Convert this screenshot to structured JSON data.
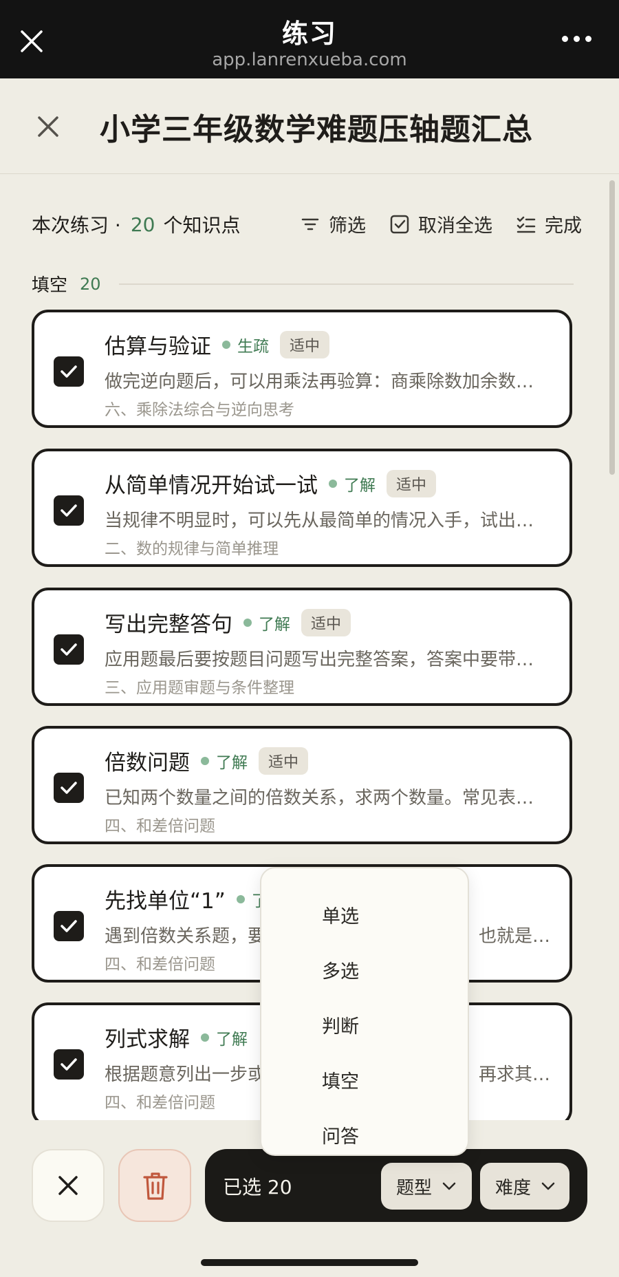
{
  "browser": {
    "title": "练习",
    "url": "app.lanrenxueba.com"
  },
  "header": {
    "title": "小学三年级数学难题压轴题汇总"
  },
  "summary": {
    "prefix": "本次练习 ·",
    "count": "20",
    "suffix": "个知识点"
  },
  "actions": {
    "filter": "筛选",
    "deselect_all": "取消全选",
    "done": "完成"
  },
  "section": {
    "name": "填空",
    "count": "20"
  },
  "cards": [
    {
      "name": "估算与验证",
      "level": "生疏",
      "difficulty": "适中",
      "desc": "做完逆向题后，可以用乘法再验算：商乘除数加余数…",
      "chapter": "六、乘除法综合与逆向思考"
    },
    {
      "name": "从简单情况开始试一试",
      "level": "了解",
      "difficulty": "适中",
      "desc": "当规律不明显时，可以先从最简单的情况入手，试出…",
      "chapter": "二、数的规律与简单推理"
    },
    {
      "name": "写出完整答句",
      "level": "了解",
      "difficulty": "适中",
      "desc": "应用题最后要按题目问题写出完整答案，答案中要带…",
      "chapter": "三、应用题审题与条件整理"
    },
    {
      "name": "倍数问题",
      "level": "了解",
      "difficulty": "适中",
      "desc": "已知两个数量之间的倍数关系，求两个数量。常见表…",
      "chapter": "四、和差倍问题"
    },
    {
      "name": "先找单位“1”",
      "level": "了",
      "difficulty": "",
      "desc": "遇到倍数关系题，要",
      "desc_tail": "也就是…",
      "chapter": "四、和差倍问题"
    },
    {
      "name": "列式求解",
      "level": "了解",
      "difficulty": "",
      "desc": "根据题意列出一步或",
      "desc_tail": "再求其…",
      "chapter": "四、和差倍问题"
    }
  ],
  "menu": {
    "options": [
      "单选",
      "多选",
      "判断",
      "填空",
      "问答"
    ]
  },
  "bottom": {
    "selected_label": "已选 20",
    "type_label": "题型",
    "difficulty_label": "难度"
  },
  "colors": {
    "accent_green": "#3f7a52",
    "dark": "#1b1a17",
    "background": "#efede4"
  }
}
